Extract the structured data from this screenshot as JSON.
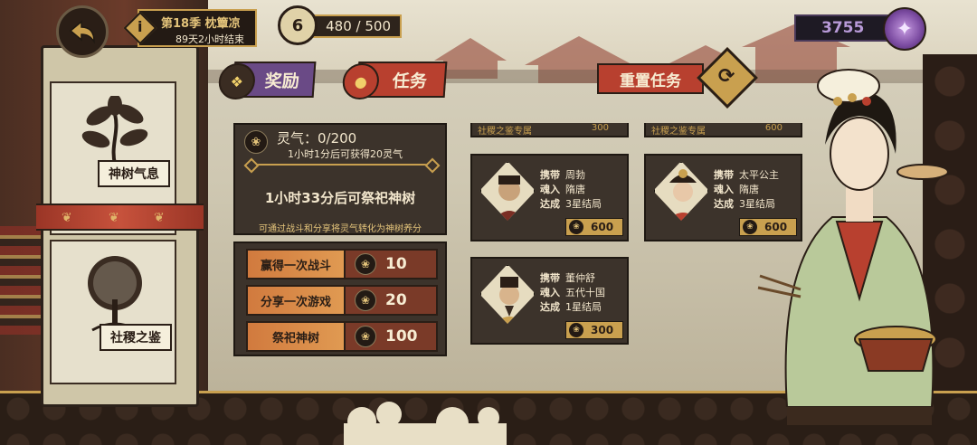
{
  "header": {
    "season_title": "第18季 枕簟凉",
    "season_remaining": "89天2小时结束",
    "stamina_level": "6",
    "stamina_value": "480 / 500",
    "currency_amount": "3755"
  },
  "tabs": [
    {
      "label": "奖励",
      "selected": false
    },
    {
      "label": "任务",
      "selected": true
    }
  ],
  "reset_button": {
    "label": "重置任务"
  },
  "sidebar": {
    "items": [
      {
        "label": "神树气息"
      },
      {
        "label": "社稷之鉴"
      }
    ]
  },
  "aura": {
    "count": "灵气：0/200",
    "gain_info": "1小时1分后可获得20灵气",
    "sacrifice_timer": "1小时33分后可祭祀神树",
    "tip": "可通过战斗和分享将灵气转化为神树养分"
  },
  "sources": [
    {
      "label": "赢得一次战斗",
      "value": "10"
    },
    {
      "label": "分享一次游戏",
      "value": "20"
    },
    {
      "label": "祭祀神树",
      "value": "100"
    }
  ],
  "partial_cards": [
    {
      "text": "社稷之鉴专属",
      "value": "300"
    },
    {
      "text": "社稷之鉴专属",
      "value": "600"
    }
  ],
  "task_cards": [
    {
      "carry_label": "携带",
      "carry": "周勃",
      "soul_label": "魂入",
      "soul": "隋唐",
      "goal_label": "达成",
      "goal": "3星结局",
      "reward": "600"
    },
    {
      "carry_label": "携带",
      "carry": "太平公主",
      "soul_label": "魂入",
      "soul": "隋唐",
      "goal_label": "达成",
      "goal": "3星结局",
      "reward": "600"
    },
    {
      "carry_label": "携带",
      "carry": "董仲舒",
      "soul_label": "魂入",
      "soul": "五代十国",
      "goal_label": "达成",
      "goal": "1星结局",
      "reward": "300"
    }
  ],
  "colors": {
    "accent_gold": "#c9a04f",
    "tab_red": "#b8402f",
    "tab_purple": "#6a4a86",
    "panel_dark": "#3c332b"
  },
  "icons": {
    "back": "back-arrow-icon",
    "season_info": "info-icon",
    "stamina": "stamina-icon",
    "currency": "dragon-coin-icon",
    "reset": "refresh-icon",
    "aura": "aura-icon"
  }
}
